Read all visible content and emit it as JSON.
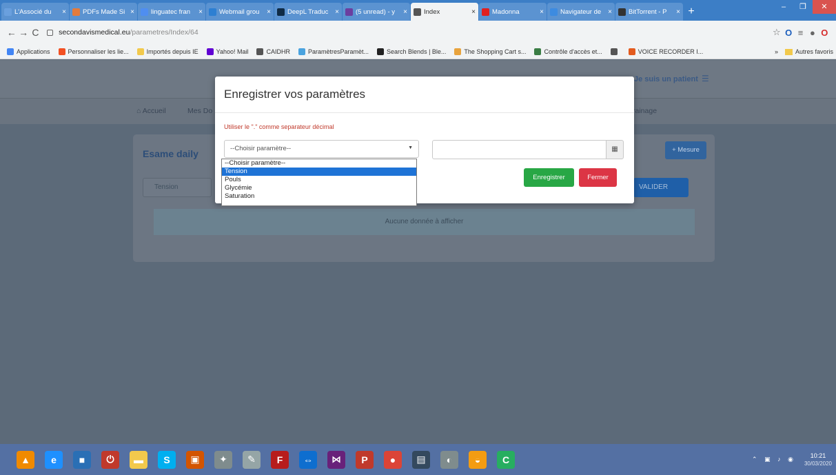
{
  "browser": {
    "tabs": [
      {
        "title": "L'Associé du",
        "color": "#6aa0de"
      },
      {
        "title": "PDFs Made Si",
        "color": "#e47b3c"
      },
      {
        "title": "linguatec fran",
        "color": "#4f8ef0"
      },
      {
        "title": "Webmail grou",
        "color": "#2d7fd2"
      },
      {
        "title": "DeepL Traduc",
        "color": "#0f2b46"
      },
      {
        "title": "(5 unread) - y",
        "color": "#6b3fa0"
      },
      {
        "title": "Index",
        "color": "#555555",
        "active": true
      },
      {
        "title": "Madonna",
        "color": "#e02020"
      },
      {
        "title": "Navigateur de",
        "color": "#3d8be0"
      },
      {
        "title": "BitTorrent - P",
        "color": "#333333"
      }
    ],
    "new_tab": "+",
    "window_controls": [
      "–",
      "❐",
      "✕"
    ],
    "url_host": "secondavismedical.eu",
    "url_path": "/parametres/Index/64",
    "bookmarks": [
      {
        "label": "Applications",
        "color": "#4285f4"
      },
      {
        "label": "Personnaliser les lie...",
        "color": "#f25022"
      },
      {
        "label": "Importés depuis IE",
        "color": "#f2c94c"
      },
      {
        "label": "Yahoo! Mail",
        "color": "#6001d2"
      },
      {
        "label": "CAIDHR",
        "color": "#555555"
      },
      {
        "label": "ParamètresParamèt...",
        "color": "#4aa3df"
      },
      {
        "label": "Search Blends | Ble...",
        "color": "#222222"
      },
      {
        "label": "The Shopping Cart s...",
        "color": "#e8a33d"
      },
      {
        "label": "Contrôle d'accès et...",
        "color": "#3a7d44"
      },
      {
        "label": "",
        "color": "#555555"
      },
      {
        "label": "VOICE RECORDER I...",
        "color": "#e35b1e"
      }
    ],
    "bookmarks_more": "»",
    "other_bookmarks": "Autres favoris"
  },
  "page": {
    "user_label": "Je suis un patient",
    "nav": [
      "Accueil",
      "Mes Do",
      "rainage"
    ],
    "card_title": "Esame daily",
    "mesure_button": "+ Mesure",
    "filter_value": "Tension",
    "validate_button": "VALIDER",
    "empty_message": "Aucune donnée à afficher"
  },
  "modal": {
    "title": "Enregistrer vos paramètres",
    "hint": "Utiliser le \".\" comme separateur décimal",
    "select_value": "--Choisir paramètre--",
    "options": [
      "--Choisir paramètre--",
      "Tension",
      "Pouls",
      "Glycémie",
      "Saturation"
    ],
    "selected_option_index": 1,
    "save_button": "Enregistrer",
    "close_button": "Fermer"
  },
  "taskbar": {
    "icons": [
      {
        "name": "vlc-icon",
        "color": "#f08a00",
        "glyph": "▲"
      },
      {
        "name": "internet-explorer-icon",
        "color": "#1e90ff",
        "glyph": "e"
      },
      {
        "name": "app-icon",
        "color": "#2a6fb5",
        "glyph": "■"
      },
      {
        "name": "power-icon",
        "color": "#c0392b",
        "glyph": "⏻"
      },
      {
        "name": "folder-icon",
        "color": "#f2c94c",
        "glyph": "▬"
      },
      {
        "name": "skype-icon",
        "color": "#00aff0",
        "glyph": "S"
      },
      {
        "name": "app-icon-2",
        "color": "#d35400",
        "glyph": "▣"
      },
      {
        "name": "network-icon",
        "color": "#7f8c8d",
        "glyph": "✦"
      },
      {
        "name": "tools-icon",
        "color": "#95a5a6",
        "glyph": "✎"
      },
      {
        "name": "filezilla-icon",
        "color": "#b71c1c",
        "glyph": "F"
      },
      {
        "name": "teamviewer-icon",
        "color": "#0e6ecf",
        "glyph": "⇔"
      },
      {
        "name": "visual-studio-icon",
        "color": "#68217a",
        "glyph": "⋈"
      },
      {
        "name": "app-p-icon",
        "color": "#c0392b",
        "glyph": "P"
      },
      {
        "name": "chrome-icon",
        "color": "#db4437",
        "glyph": "●"
      },
      {
        "name": "app-icon-3",
        "color": "#34495e",
        "glyph": "▤"
      },
      {
        "name": "app-icon-4",
        "color": "#7f8c8d",
        "glyph": "◐"
      },
      {
        "name": "vpn-icon",
        "color": "#f39c12",
        "glyph": "◒"
      },
      {
        "name": "camtasia-icon",
        "color": "#27ae60",
        "glyph": "C"
      }
    ],
    "time": "10:21",
    "date": "30/03/2020"
  }
}
